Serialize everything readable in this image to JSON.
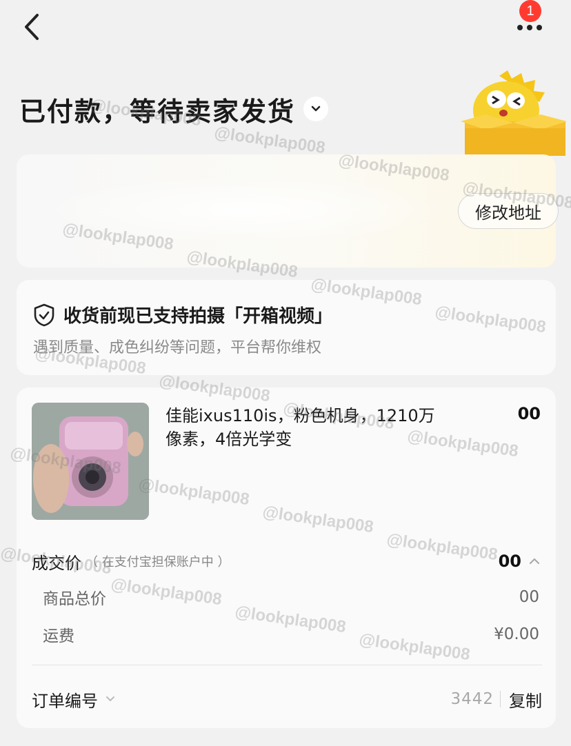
{
  "header": {
    "badge_count": "1"
  },
  "status": {
    "title": "已付款，等待卖家发货"
  },
  "address": {
    "edit_label": "修改地址"
  },
  "video": {
    "title": "收货前现已支持拍摄「开箱视频」",
    "subtitle": "遇到质量、成色纠纷等问题，平台帮你维权"
  },
  "product": {
    "name": "佳能ixus110is，粉色机身，1210万像素，4倍光学变",
    "price_visible": "00"
  },
  "pricing": {
    "deal_label": "成交价",
    "deal_hint": "（ 在支付宝担保账户中 ）",
    "deal_value_visible": "00",
    "subtotal_label": "商品总价",
    "subtotal_value_visible": "00",
    "shipping_label": "运费",
    "shipping_value": "¥0.00"
  },
  "order": {
    "number_label": "订单编号",
    "number_visible": "3442",
    "copy_label": "复制"
  },
  "watermark": {
    "text": "@lookplap008"
  },
  "colors": {
    "badge": "#ff3b30",
    "mascot": "#f7d22e"
  }
}
